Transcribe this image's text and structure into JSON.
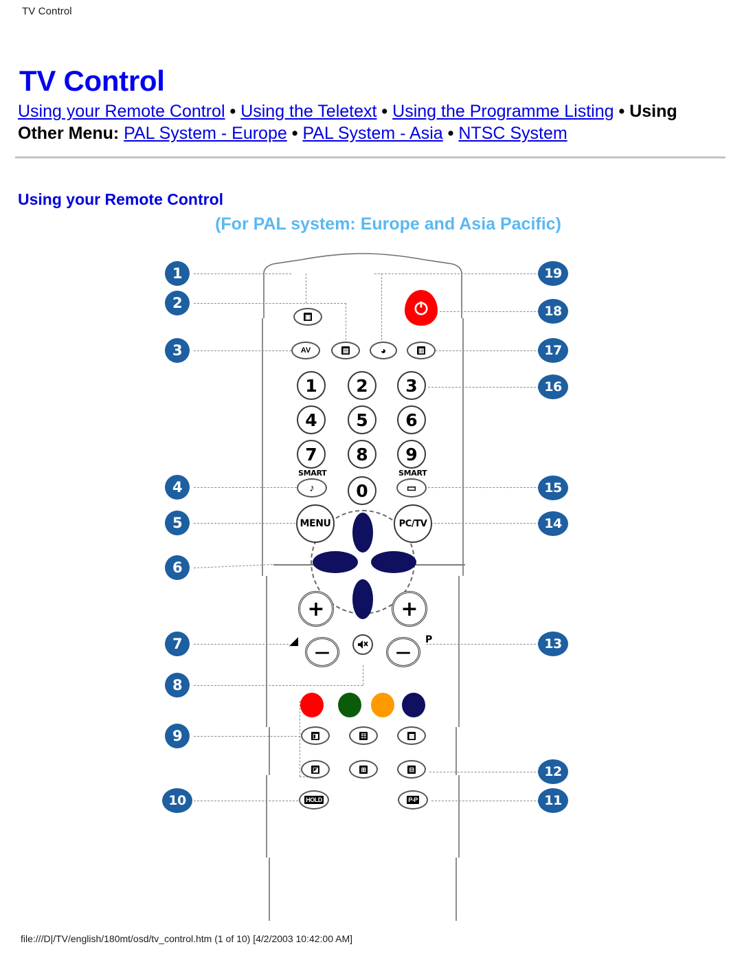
{
  "page_header": "TV Control",
  "main_title": "TV Control",
  "nav": {
    "bullet": "•",
    "line1": [
      {
        "text": "Using your Remote Control",
        "link": true
      },
      {
        "text": "Using the Teletext",
        "link": true
      },
      {
        "text": "Using the Programme Listing",
        "link": true
      }
    ],
    "trailing_label": "Using Other Menu:",
    "line2": [
      {
        "text": "PAL System - Europe",
        "link": true
      },
      {
        "text": "PAL System - Asia",
        "link": true
      },
      {
        "text": "NTSC System",
        "link": true
      }
    ]
  },
  "section_heading": "Using your Remote Control",
  "subtitle": "(For PAL system: Europe and Asia Pacific)",
  "remote": {
    "callouts_left": [
      "1",
      "2",
      "3",
      "4",
      "5",
      "6",
      "7",
      "8",
      "9",
      "10"
    ],
    "callouts_right": [
      "19",
      "18",
      "17",
      "16",
      "15",
      "14",
      "13",
      "12",
      "11"
    ],
    "keys": {
      "picture_format": "picture-format-icon",
      "av": "AV",
      "teletext": "teletext-icon",
      "clock": "clock-icon",
      "index": "index-icon",
      "power": "power-icon",
      "numbers": [
        "1",
        "2",
        "3",
        "4",
        "5",
        "6",
        "7",
        "8",
        "9",
        "0"
      ],
      "smart_sound_label": "SMART",
      "smart_picture_label": "SMART",
      "smart_sound_glyph": "♪",
      "smart_picture_glyph": "▭",
      "menu": "MENU",
      "pctv": "PC/TV",
      "volume_symbol": "◢",
      "program_symbol": "P",
      "plus": "+",
      "minus": "—",
      "mute": "mute-icon",
      "color_buttons": [
        "red",
        "green",
        "orange",
        "navy"
      ],
      "teletext_row1": [
        "reveal-icon",
        "subpage-icon",
        "subtitle-icon"
      ],
      "teletext_row2": [
        "enlarge-icon",
        "time-icon",
        "hold-icon"
      ],
      "hold": "HOLD",
      "pip": "P-P"
    },
    "colors": {
      "badge": "#1D5FA0",
      "power": "#FF0000",
      "red": "#FF0000",
      "green": "#0A5C0A",
      "orange": "#FF9900",
      "navy": "#101060",
      "arrow": "#101060"
    }
  },
  "footer": "file:///D|/TV/english/180mt/osd/tv_control.htm (1 of 10) [4/2/2003 10:42:00 AM]"
}
